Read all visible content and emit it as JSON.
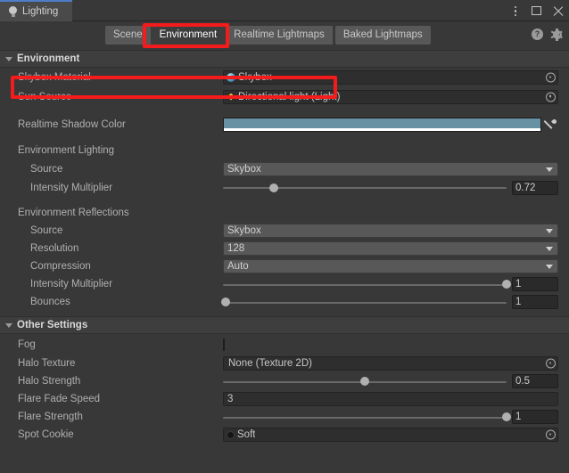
{
  "window": {
    "tab_title": "Lighting",
    "tab_icon": "lightbulb-icon",
    "controls": {
      "menu": "kebab-menu-icon",
      "maximize": "maximize-icon",
      "close": "close-icon"
    }
  },
  "toolbar": {
    "tabs": [
      {
        "label": "Scene",
        "selected": false
      },
      {
        "label": "Environment",
        "selected": true
      },
      {
        "label": "Realtime Lightmaps",
        "selected": false
      },
      {
        "label": "Baked Lightmaps",
        "selected": false
      }
    ],
    "help_icon": "help-icon",
    "settings_icon": "gear-icon"
  },
  "environment_section": {
    "header": "Environment",
    "skybox_material": {
      "label": "Skybox Material",
      "value": "Skybox",
      "icon": "material-sphere-icon"
    },
    "sun_source": {
      "label": "Sun Source",
      "value": "Directional light (Light)",
      "icon": "light-icon"
    },
    "realtime_shadow_color": {
      "label": "Realtime Shadow Color",
      "color": "#6892a4",
      "alpha_color": "#ffffff",
      "eyedropper_icon": "eyedropper-icon"
    },
    "environment_lighting": {
      "group_label": "Environment Lighting",
      "source": {
        "label": "Source",
        "value": "Skybox"
      },
      "intensity_multiplier": {
        "label": "Intensity Multiplier",
        "value": "0.72",
        "percent": 18
      }
    },
    "environment_reflections": {
      "group_label": "Environment Reflections",
      "source": {
        "label": "Source",
        "value": "Skybox"
      },
      "resolution": {
        "label": "Resolution",
        "value": "128"
      },
      "compression": {
        "label": "Compression",
        "value": "Auto"
      },
      "intensity_multiplier": {
        "label": "Intensity Multiplier",
        "value": "1",
        "percent": 100
      },
      "bounces": {
        "label": "Bounces",
        "value": "1",
        "percent": 1
      }
    }
  },
  "other_settings": {
    "header": "Other Settings",
    "fog": {
      "label": "Fog",
      "checked": false
    },
    "halo_texture": {
      "label": "Halo Texture",
      "value": "None (Texture 2D)"
    },
    "halo_strength": {
      "label": "Halo Strength",
      "value": "0.5",
      "percent": 50
    },
    "flare_fade_speed": {
      "label": "Flare Fade Speed",
      "value": "3"
    },
    "flare_strength": {
      "label": "Flare Strength",
      "value": "1",
      "percent": 100
    },
    "spot_cookie": {
      "label": "Spot Cookie",
      "value": "Soft",
      "icon": "cookie-dot-icon"
    }
  },
  "annotations": {
    "highlight_tab": "Environment",
    "highlight_row": "Skybox Material",
    "color": "#f31b1b"
  }
}
